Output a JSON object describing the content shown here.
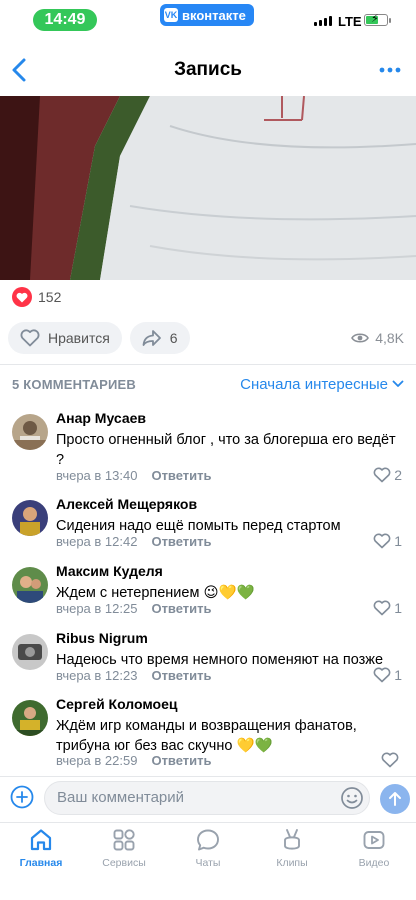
{
  "status_bar": {
    "time": "14:49",
    "app_pill": "вконтакте",
    "network": "LTE",
    "battery_level": 0.55
  },
  "nav": {
    "title": "Запись"
  },
  "post": {
    "reaction_count": "152",
    "like_label": "Нравится",
    "share_count": "6",
    "views": "4,8K"
  },
  "comments_header": {
    "count_label": "5 КОММЕНТАРИЕВ",
    "sort_label": "Сначала интересные"
  },
  "comments": [
    {
      "author": "Анар Мусаев",
      "text": "Просто огненный блог , что за блогерша его ведёт ?",
      "time": "вчера в 13:40",
      "reply": "Ответить",
      "likes": "2"
    },
    {
      "author": "Алексей Мещеряков",
      "text": "Сидения надо ещё помыть перед стартом",
      "time": "вчера в 12:42",
      "reply": "Ответить",
      "likes": "1"
    },
    {
      "author": "Максим Куделя",
      "text": "Ждем с нетерпением 😉💛💚",
      "time": "вчера в 12:25",
      "reply": "Ответить",
      "likes": "1"
    },
    {
      "author": "Ribus Nigrum",
      "text": "Надеюсь что время немного поменяют на позже",
      "time": "вчера в 12:23",
      "reply": "Ответить",
      "likes": "1"
    },
    {
      "author": "Сергей Коломоец",
      "text": "Ждём игр команды и возвращения фанатов, трибуна юг без вас скучно 💛💚",
      "time": "вчера в 22:59",
      "reply": "Ответить",
      "likes": ""
    }
  ],
  "comment_input": {
    "placeholder": "Ваш комментарий"
  },
  "tabs": [
    {
      "label": "Главная",
      "icon": "home-icon",
      "active": true
    },
    {
      "label": "Сервисы",
      "icon": "services-icon",
      "active": false
    },
    {
      "label": "Чаты",
      "icon": "chat-icon",
      "active": false
    },
    {
      "label": "Клипы",
      "icon": "clips-icon",
      "active": false
    },
    {
      "label": "Видео",
      "icon": "video-icon",
      "active": false
    }
  ],
  "colors": {
    "accent": "#2688eb",
    "heart": "#ff3347",
    "status_green": "#34c759",
    "vk_blue": "#2787f5"
  }
}
